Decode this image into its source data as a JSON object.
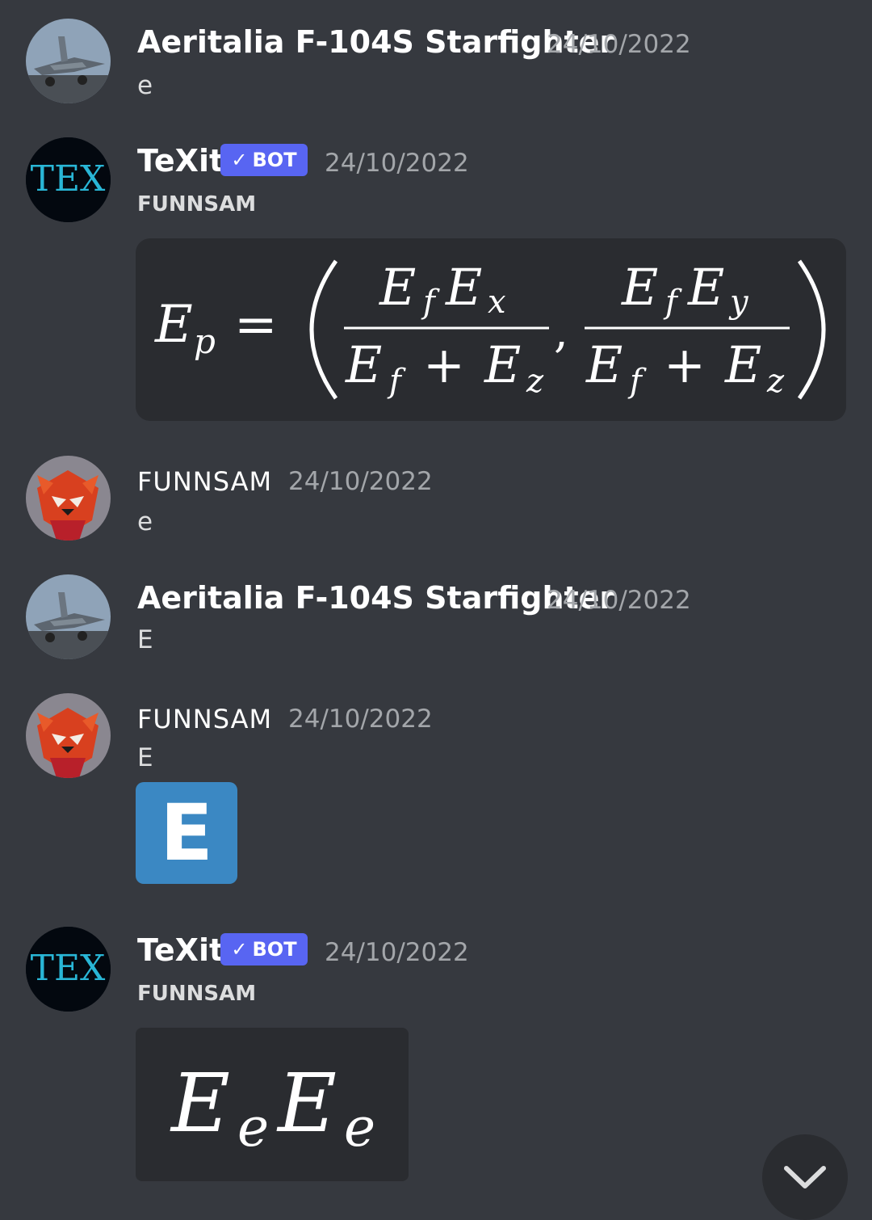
{
  "messages": [
    {
      "author": "Aeritalia F-104S Starfighter",
      "timestamp": "24/10/2022",
      "text": "e",
      "avatar": "jet-avatar-icon"
    },
    {
      "author": "TeXit",
      "badge": "BOT",
      "timestamp": "24/10/2022",
      "reply_to": "FUNNSAM",
      "avatar": "tex-logo-icon",
      "avatar_text": "TEX"
    },
    {
      "author": "FUNNSAM",
      "timestamp": "24/10/2022",
      "text": "e",
      "avatar": "red-panda-avatar-icon"
    },
    {
      "author": "Aeritalia F-104S Starfighter",
      "timestamp": "24/10/2022",
      "text": "E",
      "avatar": "jet-avatar-icon"
    },
    {
      "author": "FUNNSAM",
      "timestamp": "24/10/2022",
      "text": "E",
      "emoji_text": "E",
      "avatar": "red-panda-avatar-icon"
    },
    {
      "author": "TeXit",
      "badge": "BOT",
      "timestamp": "24/10/2022",
      "reply_to": "FUNNSAM",
      "avatar": "tex-logo-icon",
      "avatar_text": "TEX"
    }
  ],
  "formula1": {
    "lhs": "E",
    "lhs_sub": "p",
    "eq": "=",
    "num1": "E",
    "num1_sub": "f",
    "num1b": "E",
    "num1b_sub": "x",
    "den1": "E",
    "den1_sub": "f",
    "plus": "+",
    "den1b": "E",
    "den1b_sub": "z",
    "comma": ",",
    "num2": "E",
    "num2_sub": "f",
    "num2b": "E",
    "num2b_sub": "y",
    "den2": "E",
    "den2_sub": "f",
    "den2b": "E",
    "den2b_sub": "z"
  },
  "formula2": {
    "a": "E",
    "a_sub": "e",
    "b": "E",
    "b_sub": "e"
  },
  "colors": {
    "background": "#36393f",
    "bot_badge": "#5865f2",
    "emoji_blue": "#3b88c3",
    "tex_cyan": "#29b6d6"
  }
}
